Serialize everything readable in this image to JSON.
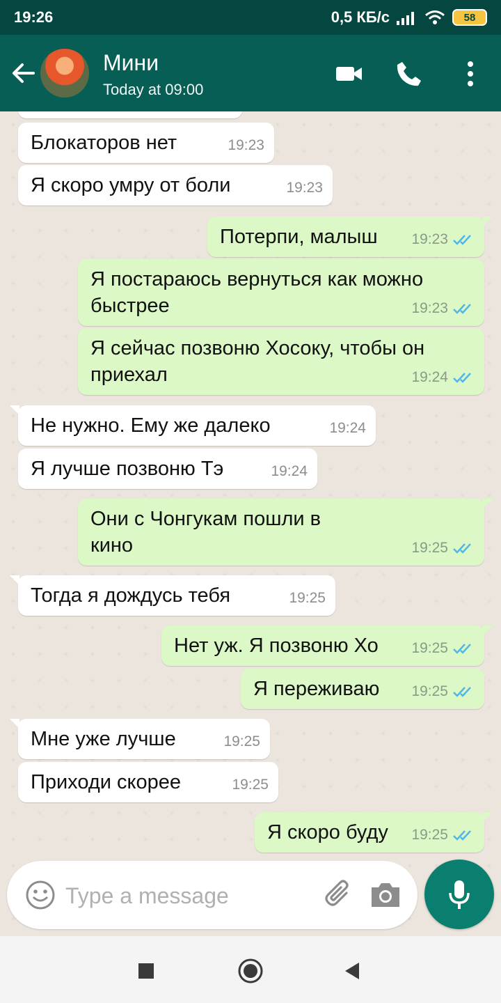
{
  "status_bar": {
    "time": "19:26",
    "network_speed": "0,5 КБ/с",
    "battery": "58"
  },
  "header": {
    "contact_name": "Мини",
    "contact_status": "Today at 09:00",
    "icons": [
      "back-arrow-icon",
      "video-call-icon",
      "phone-icon",
      "more-vert-icon"
    ]
  },
  "messages": [
    {
      "direction": "in",
      "text": "Блокаторов нет",
      "time": "19:23"
    },
    {
      "direction": "in",
      "text": "Я скоро умру от боли",
      "time": "19:23"
    },
    {
      "direction": "out",
      "text": "Потерпи, малыш",
      "time": "19:23",
      "read": true
    },
    {
      "direction": "out",
      "text": "Я постараюсь вернуться как можно быстрее",
      "time": "19:23",
      "read": true
    },
    {
      "direction": "out",
      "text": "Я сейчас позвоню Хосоку, чтобы он приехал",
      "time": "19:24",
      "read": true
    },
    {
      "direction": "in",
      "text": "Не нужно. Ему же далеко",
      "time": "19:24"
    },
    {
      "direction": "in",
      "text": "Я лучше позвоню Тэ",
      "time": "19:24"
    },
    {
      "direction": "out",
      "text": "Они с Чонгукам пошли в кино",
      "time": "19:25",
      "read": true
    },
    {
      "direction": "in",
      "text": "Тогда я дождусь тебя",
      "time": "19:25"
    },
    {
      "direction": "out",
      "text": "Нет уж. Я позвоню Хо",
      "time": "19:25",
      "read": true
    },
    {
      "direction": "out",
      "text": "Я переживаю",
      "time": "19:25",
      "read": true
    },
    {
      "direction": "in",
      "text": "Мне уже лучше",
      "time": "19:25"
    },
    {
      "direction": "in",
      "text": "Приходи скорее",
      "time": "19:25"
    },
    {
      "direction": "out",
      "text": "Я скоро буду",
      "time": "19:25",
      "read": true
    }
  ],
  "composer": {
    "placeholder": "Type a message",
    "icons": [
      "emoji-icon",
      "attach-icon",
      "camera-icon",
      "mic-icon"
    ]
  },
  "colors": {
    "header": "#075e54",
    "status_bar": "#054740",
    "incoming_bubble": "#ffffff",
    "outgoing_bubble": "#dcf8c6",
    "read_tick": "#4fb6ec",
    "chat_background": "#ece5dd",
    "mic_button": "#0a7f70"
  }
}
